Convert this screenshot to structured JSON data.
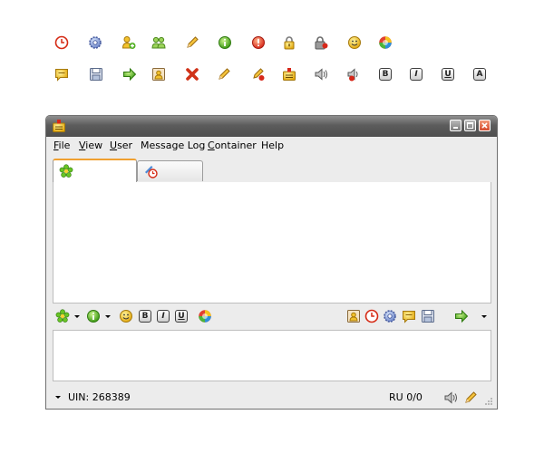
{
  "window": {
    "menus": [
      {
        "pre": "",
        "u": "F",
        "post": "ile"
      },
      {
        "pre": "",
        "u": "V",
        "post": "iew"
      },
      {
        "pre": "",
        "u": "U",
        "post": "ser"
      },
      {
        "pre": "",
        "u": "",
        "post": "Message Log"
      },
      {
        "pre": "",
        "u": "C",
        "post": "ontainer"
      },
      {
        "pre": "",
        "u": "",
        "post": "Help"
      }
    ],
    "format_buttons": {
      "bold": "B",
      "italic": "I",
      "underline": "U",
      "font": "A"
    }
  },
  "status": {
    "uin": "UIN: 268389",
    "lang": "RU 0/0"
  },
  "icons": {
    "clock": "clock-icon",
    "gear": "gear-icon",
    "add_user": "add-user-icon",
    "users": "users-icon",
    "pencil": "pencil-icon",
    "info": "info-icon",
    "alert": "alert-icon",
    "lock": "lock-icon",
    "lock_user": "lock-user-icon",
    "smiley": "smiley-icon",
    "color": "color-icon",
    "message": "message-icon",
    "save": "save-icon",
    "arrow": "arrow-right-icon",
    "contact_card": "contact-card-icon",
    "delete": "delete-icon",
    "eraser": "eraser-icon",
    "pager": "pager-icon",
    "sound": "sound-icon",
    "sound_blocked": "sound-blocked-icon",
    "flower": "icq-flower-icon",
    "clock_tab": "history-clock-icon"
  }
}
